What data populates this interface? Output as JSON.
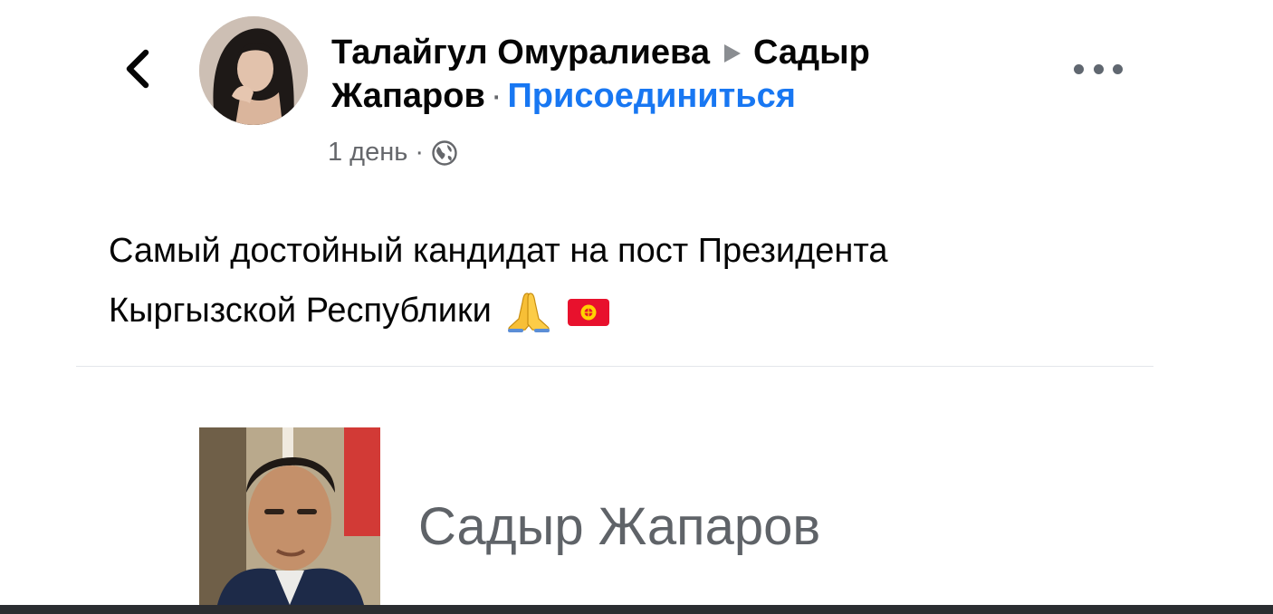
{
  "post": {
    "author_name": "Талайгул Омуралиева",
    "target_name_line1": "Садыр",
    "target_name_line2": "Жапаров",
    "separator": "·",
    "join_label": "Присоединиться",
    "timestamp": "1 день",
    "meta_separator": "·",
    "privacy_icon": "globe-icon",
    "text_line1": "Самый достойный кандидат на пост Президента",
    "text_line2": "Кыргызской Республики"
  },
  "link_card": {
    "title": "Садыр Жапаров"
  },
  "icons": {
    "back": "chevron-left-icon",
    "more": "more-dots-icon",
    "emoji_1": "folded-hands-emoji",
    "emoji_2": "kyrgyzstan-flag-emoji"
  },
  "colors": {
    "link_blue": "#1877f2",
    "secondary_text": "#65676b",
    "divider": "#e4e6eb",
    "kyrgyz_flag_red": "#e8112d"
  }
}
